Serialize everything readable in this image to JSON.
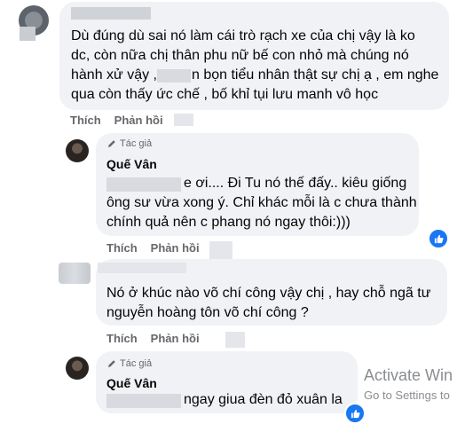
{
  "comments": [
    {
      "text_lines": [
        "Dù đúng dù sai nó làm cái trò rạch xe của chị vậy là ko",
        "dc, còn nữa chị thân phu nữ bế con nhỏ mà chúng nó",
        "hành xử vậy ,",
        "n bọn tiểu nhân thật sự chị ạ , em nghe",
        "qua còn thấy ức chế , bố khỉ tụi lưu manh vô học"
      ],
      "like_label": "Thích",
      "reply_label": "Phản hồi"
    },
    {
      "author_tag": "Tác giả",
      "name": "Quế Vân",
      "text_lines": [
        "e ơi.... Đi Tu nó thế đấy.. kiêu giống",
        "ông sư vừa xong ý. Chỉ khác mỗi là c chưa thành",
        "chính quả nên c phang nó ngay thôi:)))"
      ],
      "like_label": "Thích",
      "reply_label": "Phản hồi"
    },
    {
      "text_lines": [
        "Nó ở khúc nào võ chí công vậy chị , hay chỗ ngã tư",
        "nguyễn hoàng tôn võ chí công ?"
      ],
      "like_label": "Thích",
      "reply_label": "Phản hồi"
    },
    {
      "author_tag": "Tác giả",
      "name": "Quế Vân",
      "text_lines": [
        "ngay giua đèn đỏ xuân la"
      ]
    }
  ],
  "watermark": {
    "line1": "Activate Win",
    "line2": "Go to Settings to"
  },
  "colors": {
    "like_blue": "#1877f2",
    "bubble": "#f0f2f5",
    "muted": "#65676b"
  }
}
